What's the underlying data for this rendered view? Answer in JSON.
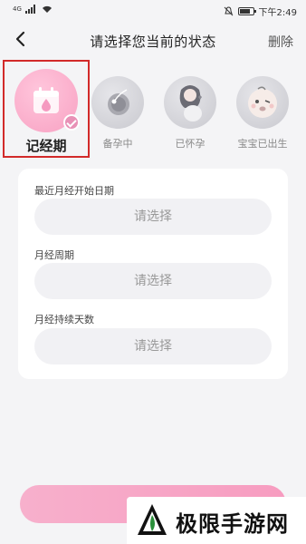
{
  "statusbar": {
    "signal": "4G",
    "time": "下午2:49",
    "icons": [
      "signal-icon",
      "wifi-icon",
      "mute-icon",
      "battery-icon"
    ]
  },
  "header": {
    "title": "请选择您当前的状态",
    "delete_label": "删除",
    "back_icon": "chevron-left-icon"
  },
  "status_options": [
    {
      "label": "记经期",
      "icon": "calendar-drop-icon",
      "selected": true
    },
    {
      "label": "备孕中",
      "icon": "sperm-egg-icon",
      "selected": false
    },
    {
      "label": "已怀孕",
      "icon": "pregnant-woman-icon",
      "selected": false
    },
    {
      "label": "宝宝已出生",
      "icon": "baby-face-icon",
      "selected": false
    }
  ],
  "form": {
    "fields": [
      {
        "label": "最近月经开始日期",
        "value": "请选择"
      },
      {
        "label": "月经周期",
        "value": "请选择"
      },
      {
        "label": "月经持续天数",
        "value": "请选择"
      }
    ]
  },
  "watermark": {
    "text": "极限手游网"
  },
  "colors": {
    "accent": "#f7a6c6",
    "selection_border": "#d22a2a",
    "background": "#f4f4f6"
  }
}
